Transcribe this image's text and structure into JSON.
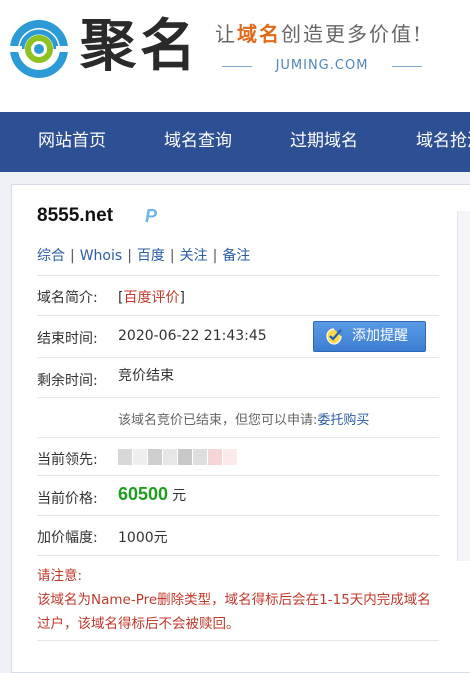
{
  "header": {
    "logo_text": "聚名",
    "slogan_prefix": "让",
    "slogan_highlight": "域名",
    "slogan_suffix": "创造更多价值!",
    "site_url": "JUMING.COM"
  },
  "nav": {
    "items": [
      {
        "label": "网站首页"
      },
      {
        "label": "域名查询"
      },
      {
        "label": "过期域名"
      },
      {
        "label": "域名抢注"
      }
    ]
  },
  "domain": {
    "name": "8555.net",
    "badge": "P"
  },
  "links": [
    {
      "label": "综合"
    },
    {
      "label": "Whois"
    },
    {
      "label": "百度"
    },
    {
      "label": "关注"
    },
    {
      "label": "备注"
    }
  ],
  "separator": "|",
  "rows": {
    "intro_label": "域名简介:",
    "intro_open": "[",
    "intro_value": "百度评价",
    "intro_close": "]",
    "end_time_label": "结束时间:",
    "end_time_value": "2020-06-22 21:43:45",
    "remind_button": "添加提醒",
    "remaining_label": "剩余时间:",
    "remaining_value": "竞价结束",
    "notice_text": "该域名竞价已结束，但您可以申请:",
    "notice_link": "委托购买",
    "leader_label": "当前领先:",
    "price_label": "当前价格:",
    "price_value": "60500",
    "price_unit": "元",
    "increment_label": "加价幅度:",
    "increment_value": "1000元"
  },
  "warning": {
    "title": "请注意:",
    "body": "该域名为Name-Pre删除类型，域名得标后会在1-15天内完成域名过户，该域名得标后不会被赎回。"
  },
  "colors": {
    "nav_bg": "#2d4f94",
    "link": "#2a5da8",
    "price": "#1e9e1e",
    "warning": "#c0392b",
    "button": "#3c7dd1"
  }
}
